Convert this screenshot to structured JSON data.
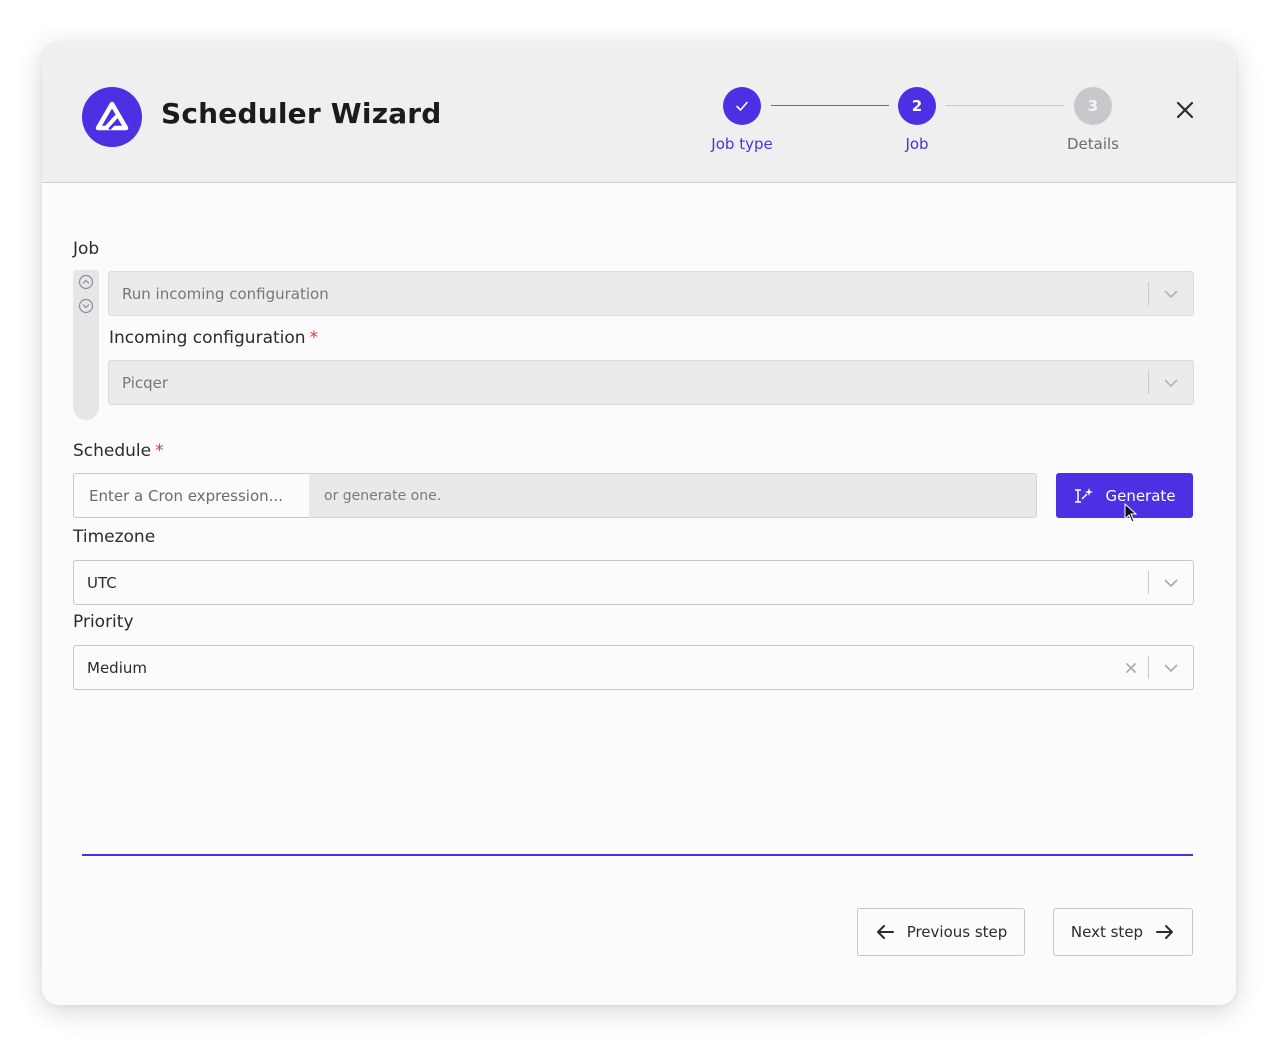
{
  "header": {
    "title": "Scheduler Wizard",
    "steps": [
      {
        "label": "Job type",
        "state": "done",
        "icon": "check-icon"
      },
      {
        "label": "Job",
        "number": "2",
        "state": "active"
      },
      {
        "label": "Details",
        "number": "3",
        "state": "todo"
      }
    ]
  },
  "form": {
    "job": {
      "label": "Job",
      "value": "Run incoming configuration"
    },
    "incoming_configuration": {
      "label": "Incoming configuration",
      "required_mark": "*",
      "value": "Picqer"
    },
    "schedule": {
      "label": "Schedule",
      "required_mark": "*",
      "input_placeholder": "Enter a Cron expression...",
      "hint": "or generate one.",
      "generate_label": "Generate"
    },
    "timezone": {
      "label": "Timezone",
      "value": "UTC"
    },
    "priority": {
      "label": "Priority",
      "value": "Medium"
    }
  },
  "footer": {
    "previous_label": "Previous step",
    "next_label": "Next step"
  },
  "colors": {
    "accent": "#4c30e3",
    "required": "#d93a2b",
    "header_bg": "#efeff0"
  }
}
